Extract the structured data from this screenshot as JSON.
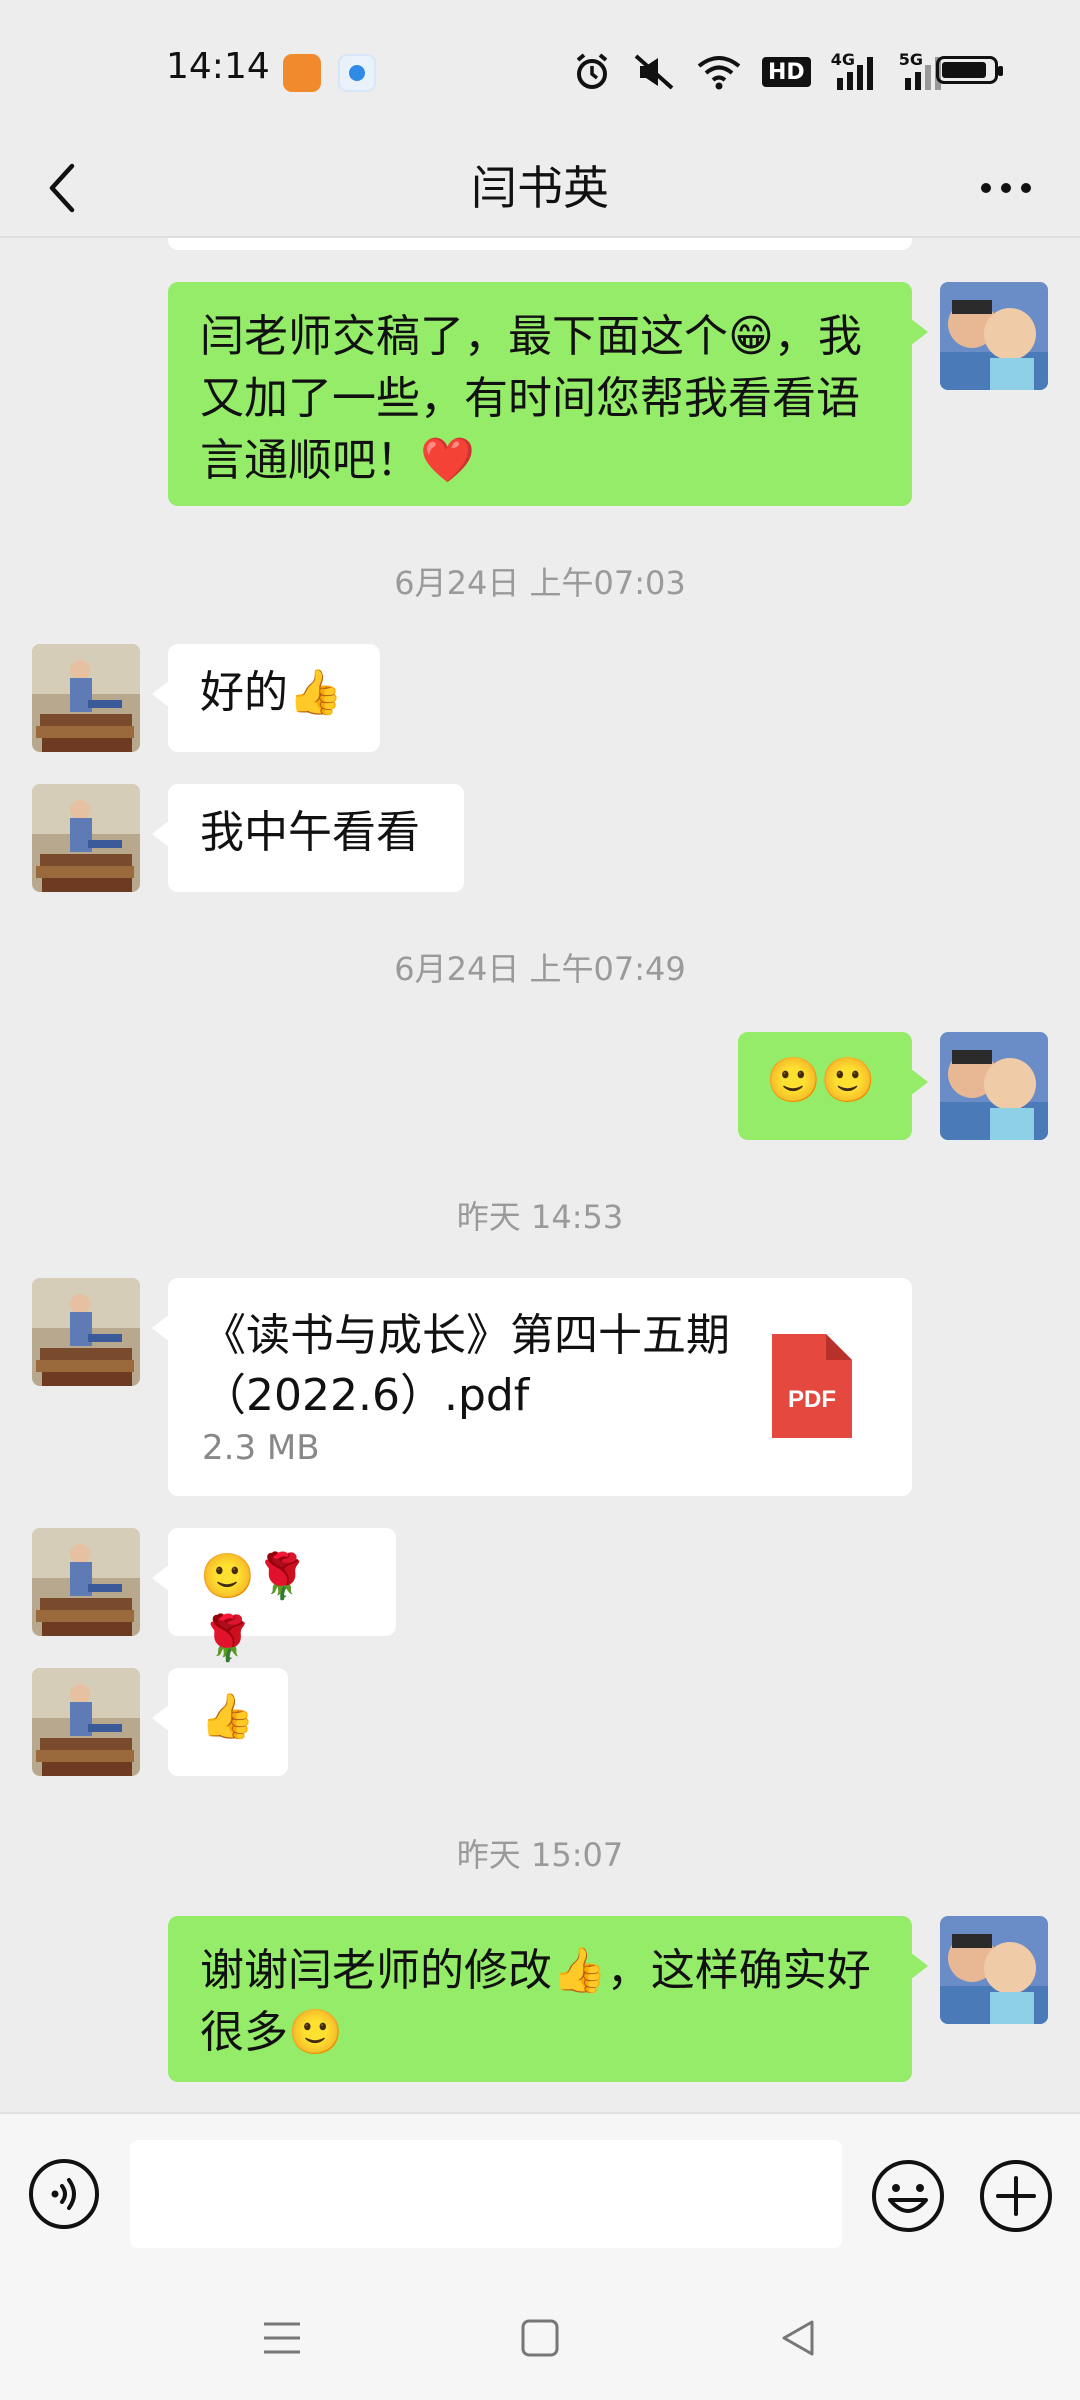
{
  "status_bar": {
    "time": "14:14",
    "icons": [
      "uc-browser-app-icon",
      "browser-app-icon",
      "alarm-icon",
      "mute-icon",
      "wifi-icon",
      "hd-icon",
      "signal-4g-icon",
      "signal-5g-icon",
      "battery-icon"
    ],
    "hd_text": "HD",
    "net1_text": "4G",
    "net2_text": "5G"
  },
  "header": {
    "title": "闫书英",
    "back_icon": "back-arrow-icon",
    "more_icon": "more-dots-icon"
  },
  "messages": [
    {
      "type": "text",
      "sender": "me",
      "text": "闫老师交稿了，最下面这个😁，我又加了一些，有时间您帮我看看语言通顺吧！❤️"
    },
    {
      "type": "timestamp",
      "text": "6月24日 上午07:03"
    },
    {
      "type": "text",
      "sender": "them",
      "text": "好的👍"
    },
    {
      "type": "text",
      "sender": "them",
      "text": "我中午看看"
    },
    {
      "type": "timestamp",
      "text": "6月24日 上午07:49"
    },
    {
      "type": "text",
      "sender": "me",
      "text": "🙂🙂"
    },
    {
      "type": "timestamp",
      "text": "昨天 14:53"
    },
    {
      "type": "file",
      "sender": "them",
      "file_name": "《读书与成长》第四十五期（2022.6）.pdf",
      "file_size": "2.3 MB",
      "file_badge": "PDF"
    },
    {
      "type": "text",
      "sender": "them",
      "text": "🙂🌹🌹"
    },
    {
      "type": "text",
      "sender": "them",
      "text": "👍"
    },
    {
      "type": "timestamp",
      "text": "昨天 15:07"
    },
    {
      "type": "text",
      "sender": "me",
      "text": "谢谢闫老师的修改👍，这样确实好很多🙂"
    }
  ],
  "input_bar": {
    "voice_icon": "voice-input-icon",
    "message_value": "",
    "emoji_icon": "emoji-icon",
    "plus_icon": "plus-icon"
  },
  "system_nav": {
    "buttons": [
      "menu-icon",
      "home-icon",
      "back-triangle-icon"
    ]
  },
  "colors": {
    "background": "#ededed",
    "my_bubble": "#95ec69",
    "their_bubble": "#ffffff",
    "timestamp_text": "#9a9a9a",
    "pdf_red": "#e5483f"
  }
}
